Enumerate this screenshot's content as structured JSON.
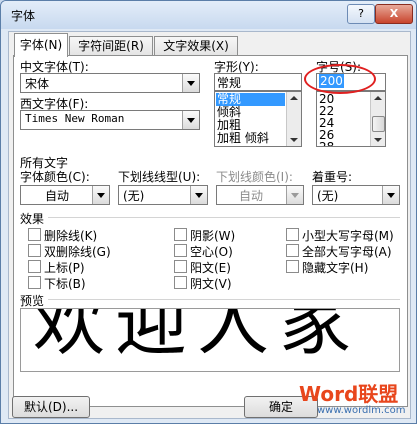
{
  "window": {
    "title": "字体",
    "help_label": "?",
    "close_label": "X"
  },
  "tabs": [
    {
      "label": "字体(N)",
      "active": true
    },
    {
      "label": "字符间距(R)",
      "active": false
    },
    {
      "label": "文字效果(X)",
      "active": false
    }
  ],
  "font": {
    "cn_label": "中文字体(T):",
    "cn_value": "宋体",
    "west_label": "西文字体(F):",
    "west_value": "Times New Roman",
    "style_label": "字形(Y):",
    "style_value": "常规",
    "style_list": [
      "常规",
      "倾斜",
      "加粗",
      "加粗 倾斜"
    ],
    "size_label": "字号(S):",
    "size_value": "200",
    "size_list": [
      "20",
      "22",
      "24",
      "26",
      "28"
    ]
  },
  "all_text": {
    "section_label": "所有文字",
    "color_label": "字体颜色(C):",
    "color_value": "自动",
    "underline_label": "下划线线型(U):",
    "underline_value": "(无)",
    "underline_color_label": "下划线颜色(I):",
    "underline_color_value": "自动",
    "emphasis_label": "着重号:",
    "emphasis_value": "(无)"
  },
  "effects": {
    "section_label": "效果",
    "items": [
      "删除线(K)",
      "双删除线(G)",
      "上标(P)",
      "下标(B)",
      "阴影(W)",
      "空心(O)",
      "阳文(E)",
      "阴文(V)",
      "小型大写字母(M)",
      "全部大写字母(A)",
      "隐藏文字(H)"
    ]
  },
  "preview": {
    "label": "预览",
    "text": "欢迎人家"
  },
  "buttons": {
    "default": "默认(D)...",
    "ok": "确定"
  },
  "watermark": {
    "brand": "Word联盟",
    "url": "www.wordlm.com"
  },
  "colors": {
    "selection": "#3399ff",
    "highlight_circle": "#e02020",
    "accent": "#5b7ea8"
  }
}
